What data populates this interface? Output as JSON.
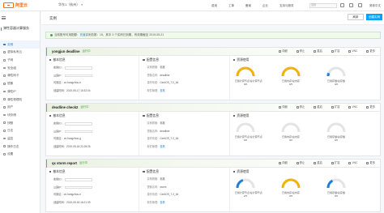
{
  "topbar": {
    "logo_text": "阿里云",
    "region": "华东1（杭州）",
    "links": [
      "费用",
      "工单",
      "备案",
      "企业",
      "支持与服务"
    ],
    "search_placeholder": "搜索",
    "lang": "简体中文"
  },
  "sidebar": {
    "title": "弹性容器计算服务",
    "items": [
      {
        "label": "实例",
        "active": true
      },
      {
        "label": "虚拟私有云",
        "active": false
      },
      {
        "label": "子网",
        "active": false
      },
      {
        "label": "安全组",
        "active": false
      },
      {
        "label": "弹性网卡",
        "active": false
      },
      {
        "label": "镜像",
        "active": false
      },
      {
        "label": "弹性IP",
        "active": false
      },
      {
        "label": "弹性物理机",
        "active": false
      },
      {
        "label": "用户",
        "active": false
      },
      {
        "label": "块存储",
        "active": false
      },
      {
        "label": "快照",
        "active": false
      },
      {
        "label": "日志",
        "active": false
      },
      {
        "label": "监控",
        "active": false
      },
      {
        "label": "操作日志",
        "active": false
      },
      {
        "label": "设置",
        "active": false
      }
    ]
  },
  "page": {
    "breadcrumb": "实例",
    "refresh_label": "刷新",
    "create_label": "创建实例"
  },
  "alert": {
    "text": "当前账号可用配额：",
    "link": "充值",
    "rest": "  实例总数：15，其中 3 个实例已到期，有效期截至 2019-05-21"
  },
  "common": {
    "basic_info": "基本信息",
    "config_info": "配置信息",
    "resource_usage": "资源使用",
    "actions": [
      "详细",
      "停止",
      "重启",
      "扩容",
      "VNC",
      "更多"
    ],
    "labels": {
      "instance_id": "实例ID：",
      "public_ip": "公网IP：",
      "region": "可用区：",
      "created": "创建时间：",
      "spec": "实例规格：",
      "image": "镜像名称：",
      "os": "操作系统：",
      "software": "软件管理："
    },
    "gauge_labels": [
      "已用计算节点/总计算节点",
      "已用内存/总内存",
      "已用存储/总存储"
    ]
  },
  "instances": [
    {
      "name": "yongjun deadline",
      "status": "运行中",
      "region": "cn-hangzhou-e",
      "created": "2019-05-17 16:32:04",
      "spec": "标准",
      "image": "deadline",
      "os": "CentOS_7.2_64",
      "software": "查看",
      "gauges": [
        {
          "value": "0/0",
          "pct": 1.0,
          "color": "#f0b400"
        },
        {
          "value": "0/5",
          "pct": 1.0,
          "color": "#f0b400"
        },
        {
          "value": "0/0",
          "pct": 0.12,
          "color": "#1c7ed6"
        }
      ]
    },
    {
      "name": "deadline check2",
      "status": "运行中",
      "region": "cn-hangzhou-g",
      "created": "2019-05-18 21:08:26",
      "spec": "标准",
      "image": "deadline",
      "os": "CentOS_7.2_64",
      "software": "查看",
      "gauges": [
        {
          "value": "0/0",
          "pct": 0.0,
          "color": "#bbbbbb"
        },
        {
          "value": "0/0",
          "pct": 0.0,
          "color": "#bbbbbb"
        },
        {
          "value": "0/0",
          "pct": 0.0,
          "color": "#bbbbbb"
        }
      ]
    },
    {
      "name": "qx storm report",
      "status": "运行中",
      "region": "cn-hangzhou-e",
      "created": "2019-05-18 16:21:39",
      "spec": "标准",
      "image": "storm",
      "os": "CentOS_7.2_64",
      "software": "查看",
      "gauges": [
        {
          "value": "2/5",
          "pct": 0.4,
          "color": "#1c7ed6"
        },
        {
          "value": "0/5",
          "pct": 1.0,
          "color": "#f0b400"
        },
        {
          "value": "0/0",
          "pct": 0.35,
          "color": "#1c7ed6"
        }
      ]
    }
  ]
}
